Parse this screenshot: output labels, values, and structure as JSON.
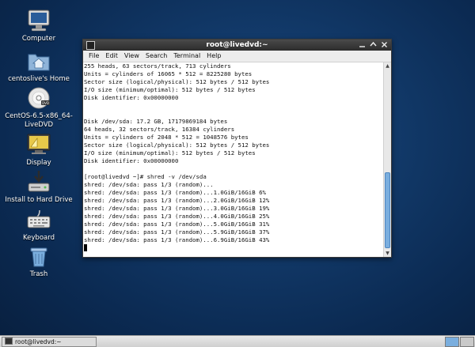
{
  "desktop_icons": [
    {
      "label": "Computer",
      "icon": "computer-icon"
    },
    {
      "label": "centoslive's Home",
      "icon": "home-folder-icon"
    },
    {
      "label": "CentOS-6.5-x86_64-LiveDVD",
      "icon": "dvd-icon"
    },
    {
      "label": "Display",
      "icon": "display-icon"
    },
    {
      "label": "Install to Hard Drive",
      "icon": "install-icon"
    },
    {
      "label": "Keyboard",
      "icon": "keyboard-icon"
    },
    {
      "label": "Trash",
      "icon": "trash-icon"
    }
  ],
  "terminal": {
    "title": "root@livedvd:~",
    "menu": [
      "File",
      "Edit",
      "View",
      "Search",
      "Terminal",
      "Help"
    ],
    "lines": [
      "255 heads, 63 sectors/track, 713 cylinders",
      "Units = cylinders of 16065 * 512 = 8225280 bytes",
      "Sector size (logical/physical): 512 bytes / 512 bytes",
      "I/O size (minimum/optimal): 512 bytes / 512 bytes",
      "Disk identifier: 0x00000000",
      "",
      "",
      "Disk /dev/sda: 17.2 GB, 17179869184 bytes",
      "64 heads, 32 sectors/track, 16384 cylinders",
      "Units = cylinders of 2048 * 512 = 1048576 bytes",
      "Sector size (logical/physical): 512 bytes / 512 bytes",
      "I/O size (minimum/optimal): 512 bytes / 512 bytes",
      "Disk identifier: 0x00000000",
      "",
      "[root@livedvd ~]# shred -v /dev/sda",
      "shred: /dev/sda: pass 1/3 (random)...",
      "shred: /dev/sda: pass 1/3 (random)...1.0GiB/16GiB 6%",
      "shred: /dev/sda: pass 1/3 (random)...2.0GiB/16GiB 12%",
      "shred: /dev/sda: pass 1/3 (random)...3.0GiB/16GiB 19%",
      "shred: /dev/sda: pass 1/3 (random)...4.0GiB/16GiB 25%",
      "shred: /dev/sda: pass 1/3 (random)...5.0GiB/16GiB 31%",
      "shred: /dev/sda: pass 1/3 (random)...5.9GiB/16GiB 37%",
      "shred: /dev/sda: pass 1/3 (random)...6.9GiB/16GiB 43%"
    ]
  },
  "taskbar": {
    "task_label": "root@livedvd:~",
    "workspace_active_color": "#7aaede"
  },
  "colors": {
    "desktop_bg": "#123a6a",
    "titlebar": "#2c2c2c",
    "scroll_thumb": "#7aaede"
  }
}
